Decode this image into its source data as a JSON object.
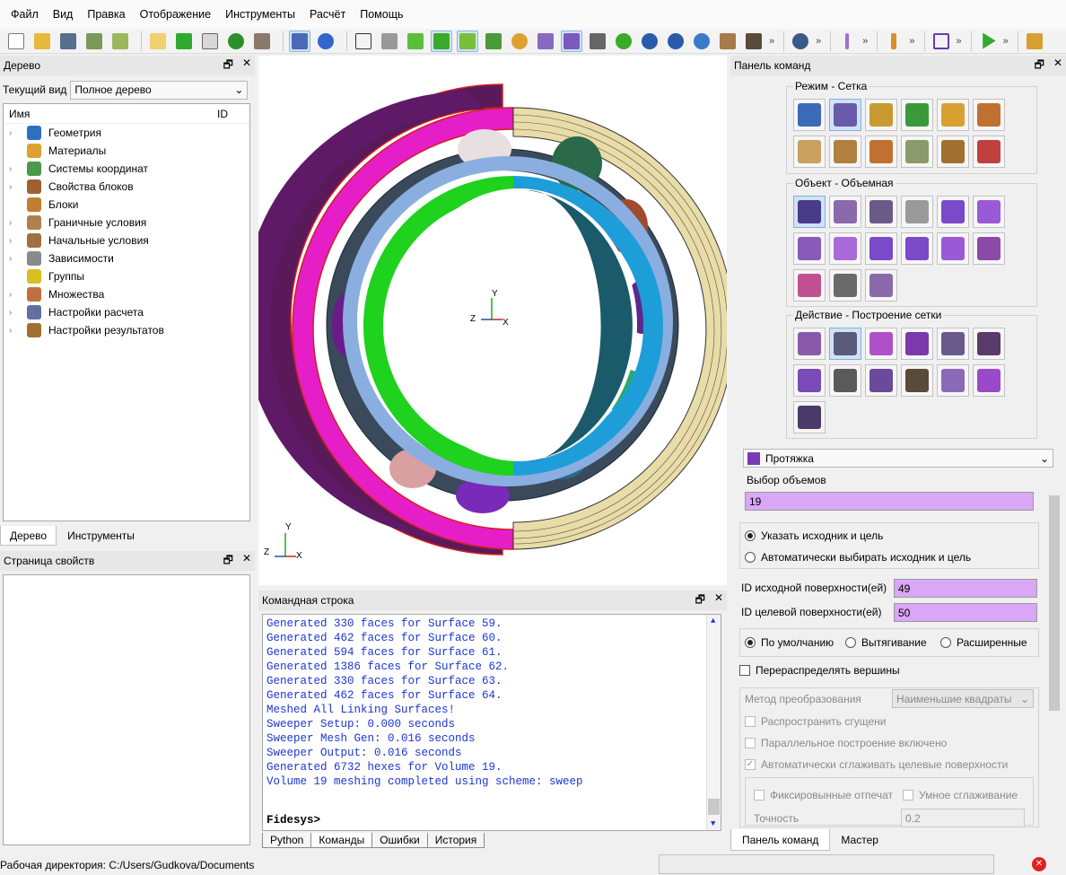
{
  "menu": [
    "Файл",
    "Вид",
    "Правка",
    "Отображение",
    "Инструменты",
    "Расчёт",
    "Помощь"
  ],
  "tree_panel": {
    "title": "Дерево",
    "view_label": "Текущий вид",
    "view_value": "Полное дерево",
    "col_name": "Имя",
    "col_id": "ID",
    "items": [
      {
        "label": "Геометрия",
        "expand": true,
        "color": "#2f6fbf"
      },
      {
        "label": "Материалы",
        "expand": false,
        "color": "#e0a030"
      },
      {
        "label": "Системы координат",
        "expand": true,
        "color": "#4a9a4a"
      },
      {
        "label": "Свойства блоков",
        "expand": true,
        "color": "#a06030"
      },
      {
        "label": "Блоки",
        "expand": false,
        "color": "#c08030"
      },
      {
        "label": "Граничные условия",
        "expand": true,
        "color": "#b08050"
      },
      {
        "label": "Начальные условия",
        "expand": true,
        "color": "#a07040"
      },
      {
        "label": "Зависимости",
        "expand": true,
        "color": "#8a8a8a"
      },
      {
        "label": "Группы",
        "expand": false,
        "color": "#d8c020"
      },
      {
        "label": "Множества",
        "expand": true,
        "color": "#c07040"
      },
      {
        "label": "Настройки расчета",
        "expand": true,
        "color": "#6070a0"
      },
      {
        "label": "Настройки результатов",
        "expand": true,
        "color": "#a07030"
      }
    ],
    "tab_tree": "Дерево",
    "tab_tools": "Инструменты"
  },
  "props_panel": {
    "title": "Страница свойств"
  },
  "viewport": {
    "axis_center": {
      "y": "Y",
      "z": "Z",
      "x": "X"
    },
    "axis_corner": {
      "y": "Y",
      "z": "Z",
      "x": "X"
    }
  },
  "command_line": {
    "title": "Командная строка",
    "lines": [
      "Generated 330 faces for Surface 59.",
      "Generated 462 faces for Surface 60.",
      "Generated 594 faces for Surface 61.",
      "Generated 1386 faces for Surface 62.",
      "Generated 330 faces for Surface 63.",
      "Generated 462 faces for Surface 64.",
      "Meshed All Linking Surfaces!",
      "Sweeper Setup: 0.000 seconds",
      "Sweeper Mesh Gen: 0.016 seconds",
      "Sweeper Output: 0.016 seconds",
      "Generated 6732 hexes for Volume 19.",
      "Volume 19 meshing completed using scheme: sweep"
    ],
    "prompt": "Fidesys>",
    "tabs": [
      "Python",
      "Команды",
      "Ошибки",
      "История"
    ]
  },
  "command_panel": {
    "title": "Панель команд",
    "group_mode": "Режим - Сетка",
    "group_object": "Объект - Объемная",
    "group_action": "Действие - Построение сетки",
    "scheme": "Протяжка",
    "volume_label": "Выбор объемов",
    "volume_value": "19",
    "radio_specify": "Указать исходник и цель",
    "radio_auto": "Автоматически выбирать исходник и цель",
    "source_label": "ID исходной поверхности(ей)",
    "source_value": "49",
    "target_label": "ID целевой поверхности(ей)",
    "target_value": "50",
    "opt_default": "По умолчанию",
    "opt_extrude": "Вытягивание",
    "opt_extended": "Расширенные",
    "redistribute": "Перераспределять вершины",
    "transform_label": "Метод преобразования",
    "transform_value": "Наименьшие квадраты",
    "propagate": "Распространить сгущени",
    "parallel": "Параллельное построение включено",
    "auto_smooth": "Автоматически сглаживать целевые поверхности",
    "fixed_imprints": "Фиксировынные отпечат",
    "smart_smooth": "Умное сглаживание",
    "accuracy_label": "Точность",
    "accuracy_value": "0.2",
    "tab_panel": "Панель команд",
    "tab_master": "Мастер"
  },
  "status": {
    "workdir": "Рабочая директория: C:/Users/Gudkova/Documents"
  }
}
